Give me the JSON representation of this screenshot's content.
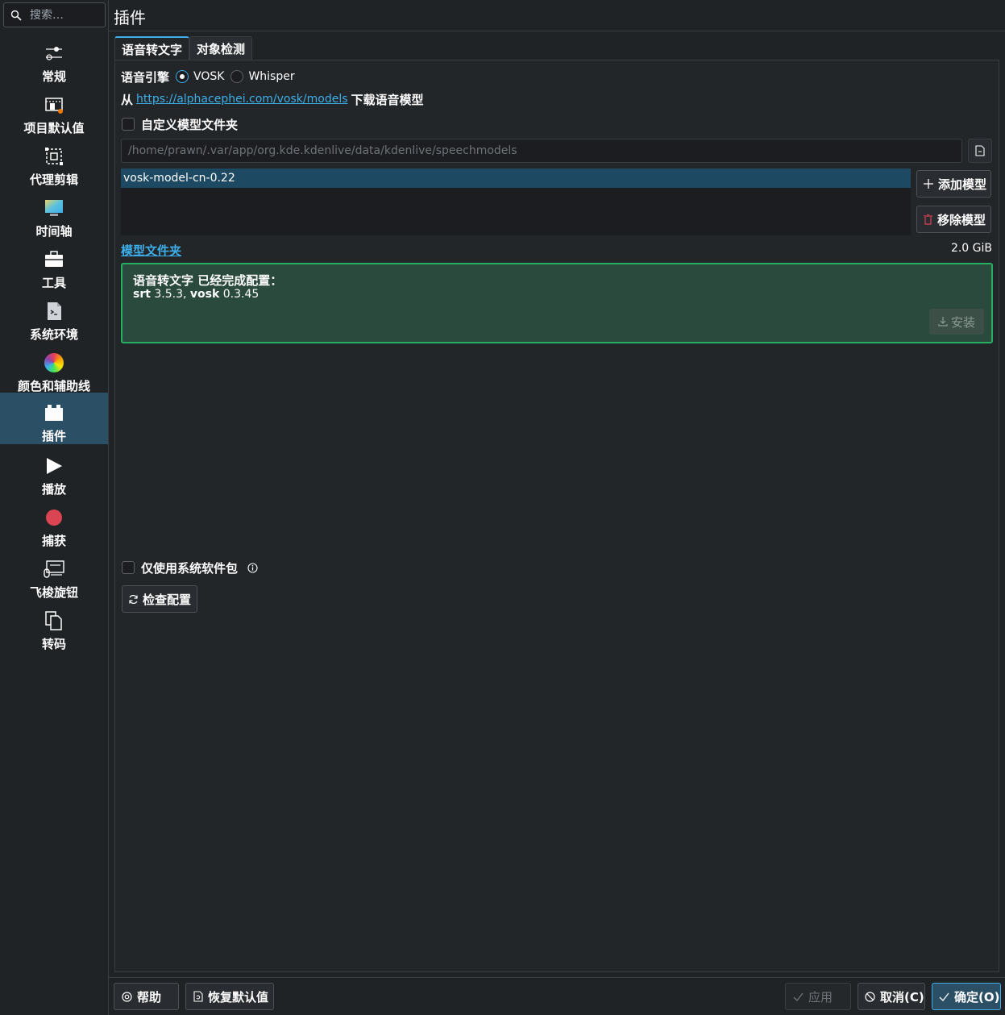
{
  "search": {
    "placeholder": "搜索…"
  },
  "sidebar": {
    "items": [
      {
        "label": "常规",
        "icon": "sliders-icon"
      },
      {
        "label": "项目默认值",
        "icon": "project-icon"
      },
      {
        "label": "代理剪辑",
        "icon": "proxy-icon"
      },
      {
        "label": "时间轴",
        "icon": "timeline-icon"
      },
      {
        "label": "工具",
        "icon": "toolbox-icon"
      },
      {
        "label": "系统环境",
        "icon": "terminal-icon"
      },
      {
        "label": "颜色和辅助线",
        "icon": "color-wheel-icon"
      },
      {
        "label": "插件",
        "icon": "plugin-icon"
      },
      {
        "label": "播放",
        "icon": "play-icon"
      },
      {
        "label": "捕获",
        "icon": "record-icon"
      },
      {
        "label": "飞梭旋钮",
        "icon": "jog-shuttle-icon"
      },
      {
        "label": "转码",
        "icon": "transcode-icon"
      }
    ],
    "active_index": 7
  },
  "page": {
    "title": "插件"
  },
  "tabs": [
    {
      "label": "语音转文字",
      "active": true
    },
    {
      "label": "对象检测",
      "active": false
    }
  ],
  "engine": {
    "label": "语音引擎",
    "options": [
      {
        "label": "VOSK",
        "selected": true
      },
      {
        "label": "Whisper",
        "selected": false
      }
    ]
  },
  "download": {
    "prefix": "从",
    "link": "https://alphacephei.com/vosk/models",
    "suffix": "下载语音模型"
  },
  "custom_folder": {
    "label": "自定义模型文件夹",
    "checked": false
  },
  "model_path": {
    "value": "/home/prawn/.var/app/org.kde.kdenlive/data/kdenlive/speechmodels"
  },
  "models": [
    "vosk-model-cn-0.22"
  ],
  "buttons": {
    "add_model": "添加模型",
    "remove_model": "移除模型",
    "install": "安装",
    "check_config": "检查配置"
  },
  "model_folder_link": "模型文件夹",
  "models_size": "2.0 GiB",
  "status": {
    "title": "语音转文字 已经完成配置：",
    "srt_name": "srt",
    "srt_version": "3.5.3,",
    "vosk_name": "vosk",
    "vosk_version": "0.3.45"
  },
  "system_packages": {
    "label": "仅使用系统软件包",
    "checked": false
  },
  "footer": {
    "help": "帮助",
    "restore_defaults": "恢复默认值",
    "apply": "应用",
    "cancel": "取消(C)",
    "ok": "确定(O)"
  },
  "colors": {
    "accent": "#3daee9",
    "success_border": "#27ae60",
    "destructive": "#da4453"
  }
}
